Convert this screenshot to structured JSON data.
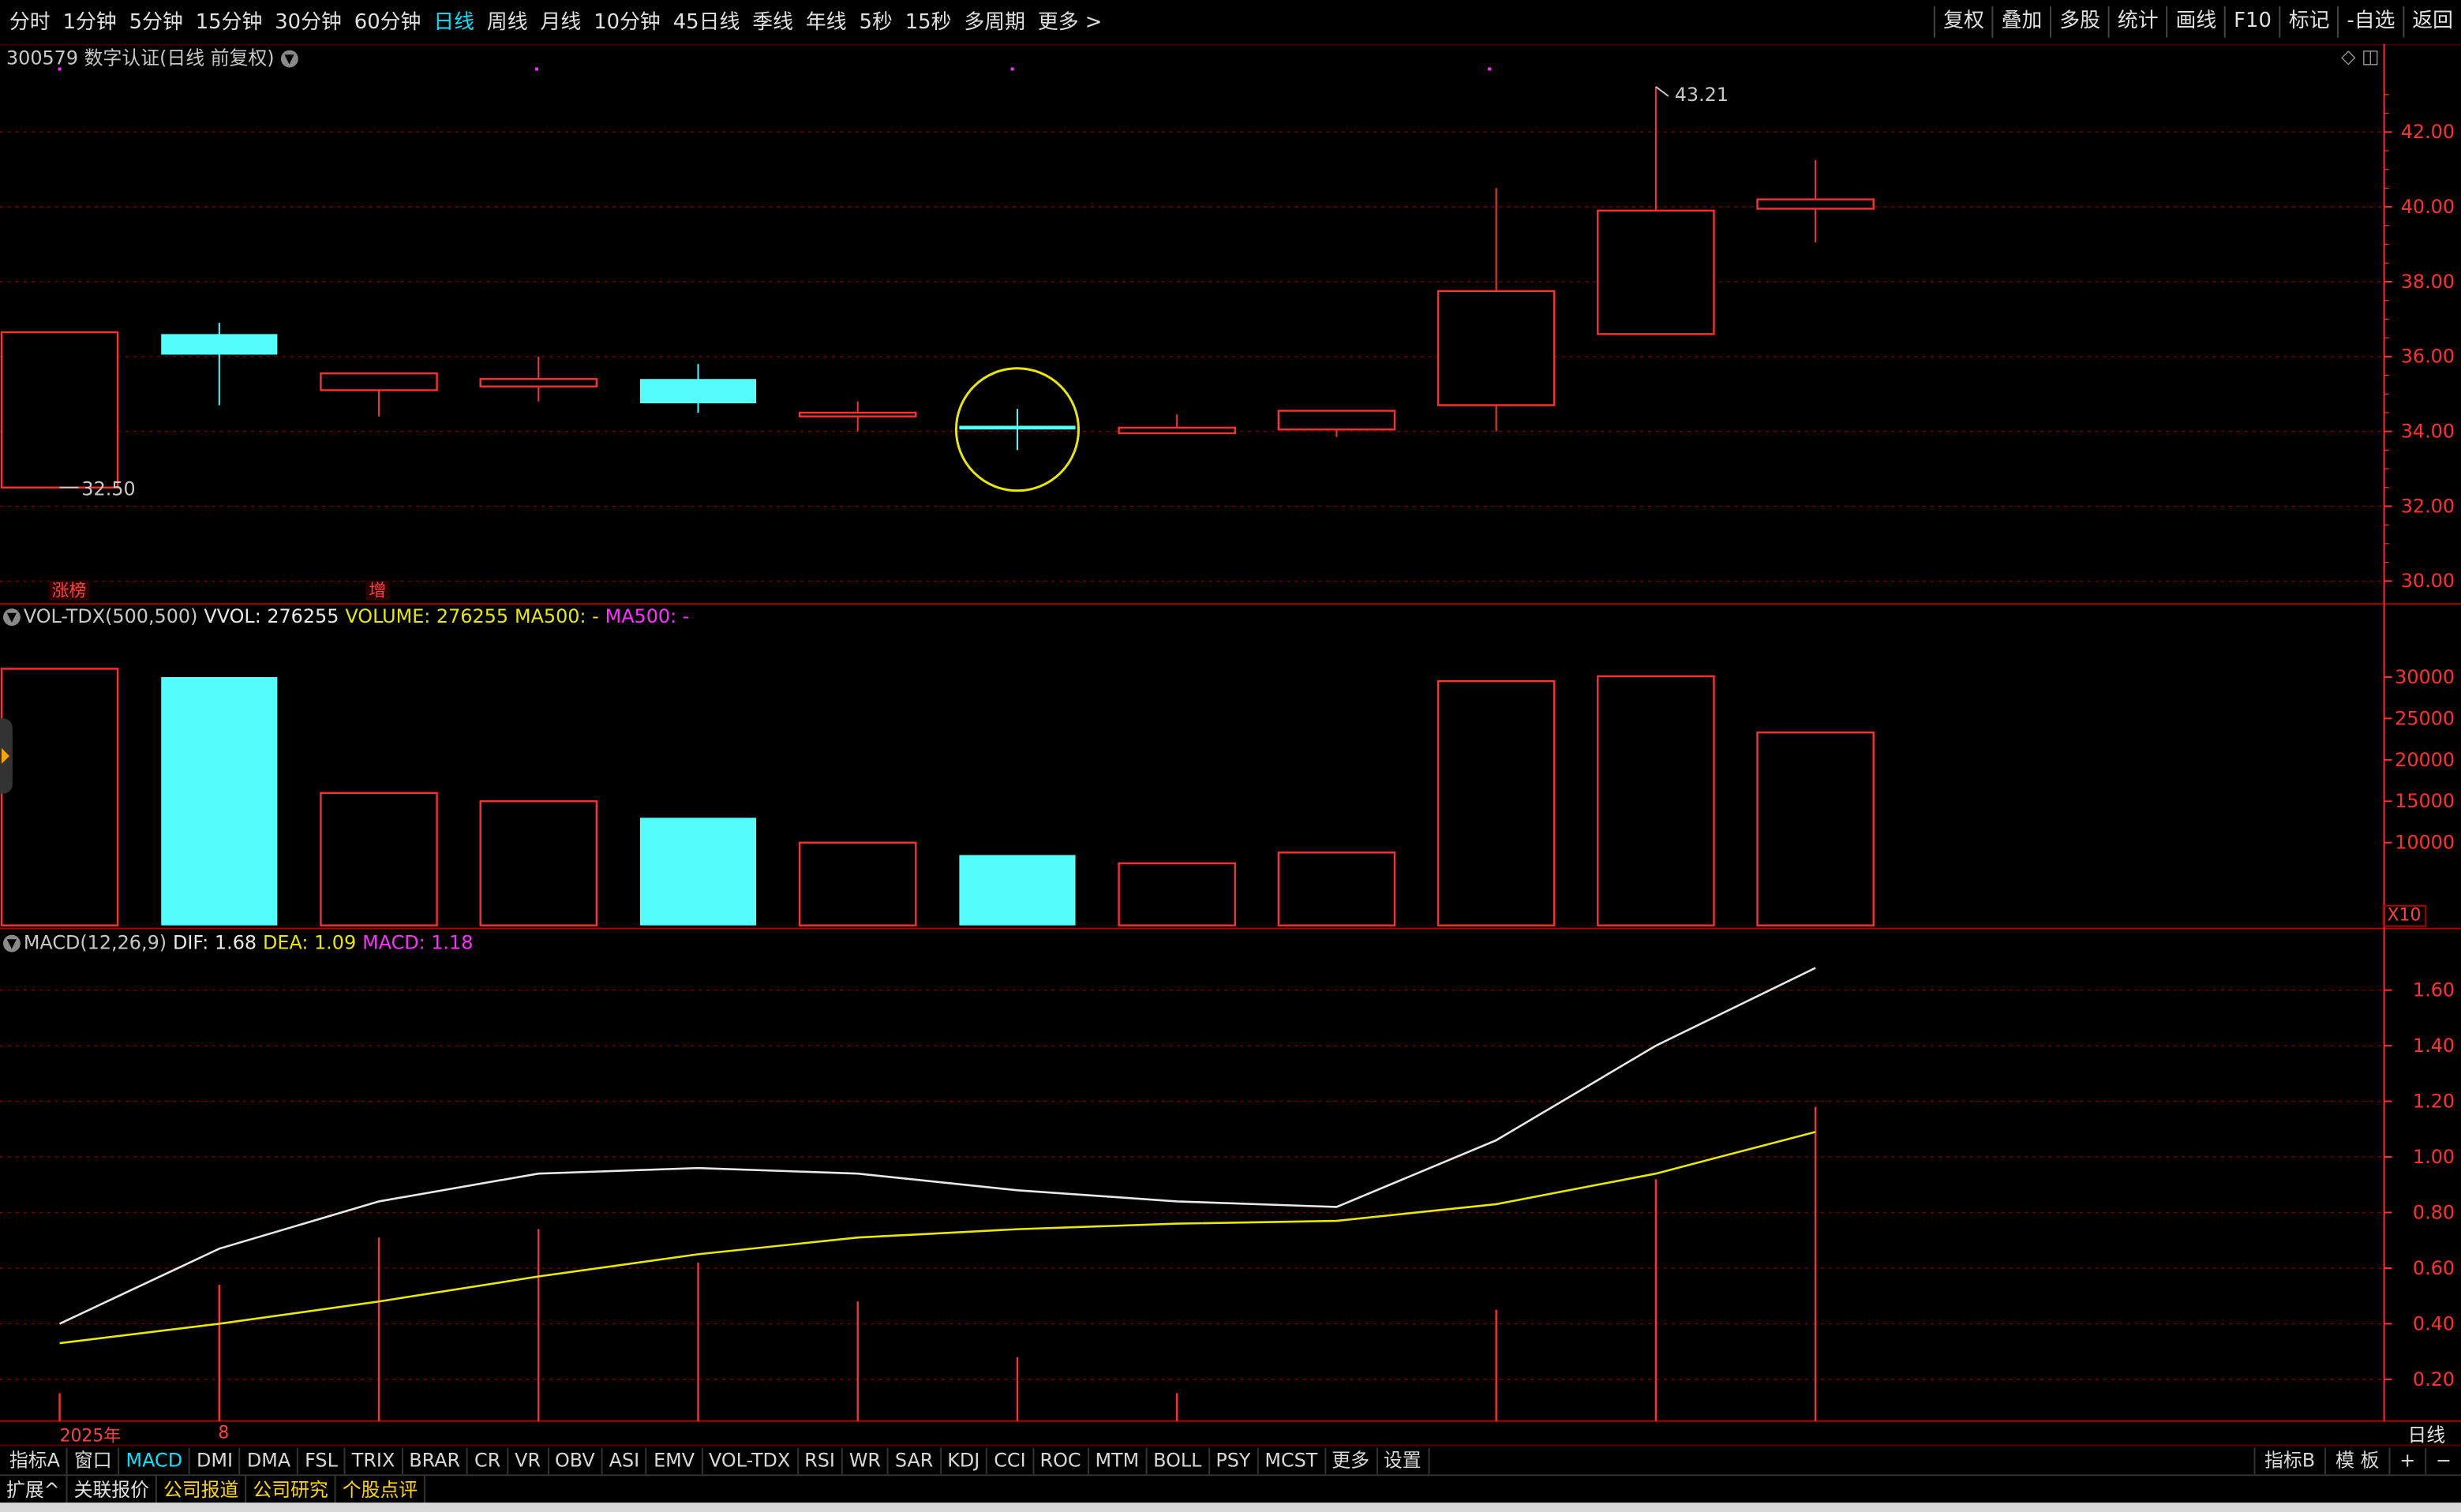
{
  "toolbar": {
    "periods": [
      "分时",
      "1分钟",
      "5分钟",
      "15分钟",
      "30分钟",
      "60分钟",
      "日线",
      "周线",
      "月线",
      "10分钟",
      "45日线",
      "季线",
      "年线",
      "5秒",
      "15秒",
      "多周期",
      "更多 >"
    ],
    "active": "日线",
    "right_buttons": [
      "复权",
      "叠加",
      "多股",
      "统计",
      "画线",
      "F10",
      "标记",
      "-自选",
      "返回"
    ]
  },
  "stock": {
    "title": "300579 数字认证(日线 前复权)"
  },
  "price_panel": {
    "high_label": "43.21",
    "low_label": "32.50",
    "y_ticks": [
      "42.00",
      "40.00",
      "38.00",
      "36.00",
      "34.00",
      "32.00",
      "30.00"
    ],
    "tags": [
      "涨榜",
      "增"
    ]
  },
  "volume_panel": {
    "header": {
      "name": "VOL-TDX(500,500)",
      "vvol": "VVOL: 276255",
      "volume": "VOLUME: 276255",
      "ma500a": "MA500: -",
      "ma500b": "MA500: -"
    },
    "y_ticks": [
      "30000",
      "25000",
      "20000",
      "15000",
      "10000"
    ],
    "unit": "X10"
  },
  "macd_panel": {
    "header": {
      "name": "MACD(12,26,9)",
      "dif": "DIF: 1.68",
      "dea": "DEA: 1.09",
      "macd": "MACD: 1.18"
    },
    "y_ticks": [
      "1.60",
      "1.40",
      "1.20",
      "1.00",
      "0.80",
      "0.60",
      "0.40",
      "0.20"
    ]
  },
  "x_labels": {
    "year": "2025年",
    "month": "8"
  },
  "period_label": "日线",
  "indicator_tabs": [
    "指标A",
    "窗口",
    "MACD",
    "DMI",
    "DMA",
    "FSL",
    "TRIX",
    "BRAR",
    "CR",
    "VR",
    "OBV",
    "ASI",
    "EMV",
    "VOL-TDX",
    "RSI",
    "WR",
    "SAR",
    "KDJ",
    "CCI",
    "ROC",
    "MTM",
    "BOLL",
    "PSY",
    "MCST",
    "更多",
    "设置"
  ],
  "indicator_active": "MACD",
  "indicator_right": [
    "指标B",
    "模 板",
    "+",
    "−"
  ],
  "news_tabs": [
    "扩展^",
    "关联报价",
    "公司报道",
    "公司研究",
    "个股点评"
  ],
  "colors": {
    "up": "#ff3030",
    "down": "#54fcfc",
    "dif": "#e8e8e8",
    "dea": "#e8e800",
    "grid": "#7a0000",
    "axis": "#ff3030"
  },
  "chart_data": {
    "type": "candlestick",
    "candles": [
      {
        "o": 32.5,
        "h": 36.65,
        "l": 32.5,
        "c": 36.65,
        "vol": 31000
      },
      {
        "o": 36.6,
        "h": 36.9,
        "l": 34.7,
        "c": 36.05,
        "vol": 30000
      },
      {
        "o": 35.1,
        "h": 35.5,
        "l": 34.4,
        "c": 35.55,
        "vol": 16000
      },
      {
        "o": 35.2,
        "h": 36.0,
        "l": 34.8,
        "c": 35.4,
        "vol": 15000
      },
      {
        "o": 35.4,
        "h": 35.8,
        "l": 34.5,
        "c": 34.75,
        "vol": 13000
      },
      {
        "o": 34.4,
        "h": 34.8,
        "l": 34.0,
        "c": 34.5,
        "vol": 10000
      },
      {
        "o": 34.15,
        "h": 34.6,
        "l": 33.5,
        "c": 34.05,
        "vol": 8500
      },
      {
        "o": 33.95,
        "h": 34.45,
        "l": 33.95,
        "c": 34.1,
        "vol": 7500
      },
      {
        "o": 34.05,
        "h": 34.55,
        "l": 33.85,
        "c": 34.55,
        "vol": 8800
      },
      {
        "o": 34.7,
        "h": 40.5,
        "l": 34.0,
        "c": 37.75,
        "vol": 29500
      },
      {
        "o": 36.6,
        "h": 43.21,
        "l": 36.6,
        "c": 39.9,
        "vol": 30100
      },
      {
        "o": 39.95,
        "h": 41.25,
        "l": 39.05,
        "c": 40.2,
        "vol": 23300
      }
    ],
    "dif": [
      0.4,
      0.67,
      0.84,
      0.94,
      0.96,
      0.94,
      0.88,
      0.84,
      0.82,
      1.06,
      1.4,
      1.68
    ],
    "dea": [
      0.33,
      0.4,
      0.48,
      0.57,
      0.65,
      0.71,
      0.74,
      0.76,
      0.77,
      0.83,
      0.94,
      1.09
    ],
    "macd": [
      0.15,
      0.54,
      0.71,
      0.74,
      0.62,
      0.48,
      0.28,
      0.15,
      0.05,
      0.45,
      0.92,
      1.18
    ],
    "price_range": [
      29.6,
      43.6
    ],
    "volume_range": [
      0,
      36000
    ],
    "macd_range": [
      0.05,
      1.72
    ]
  }
}
